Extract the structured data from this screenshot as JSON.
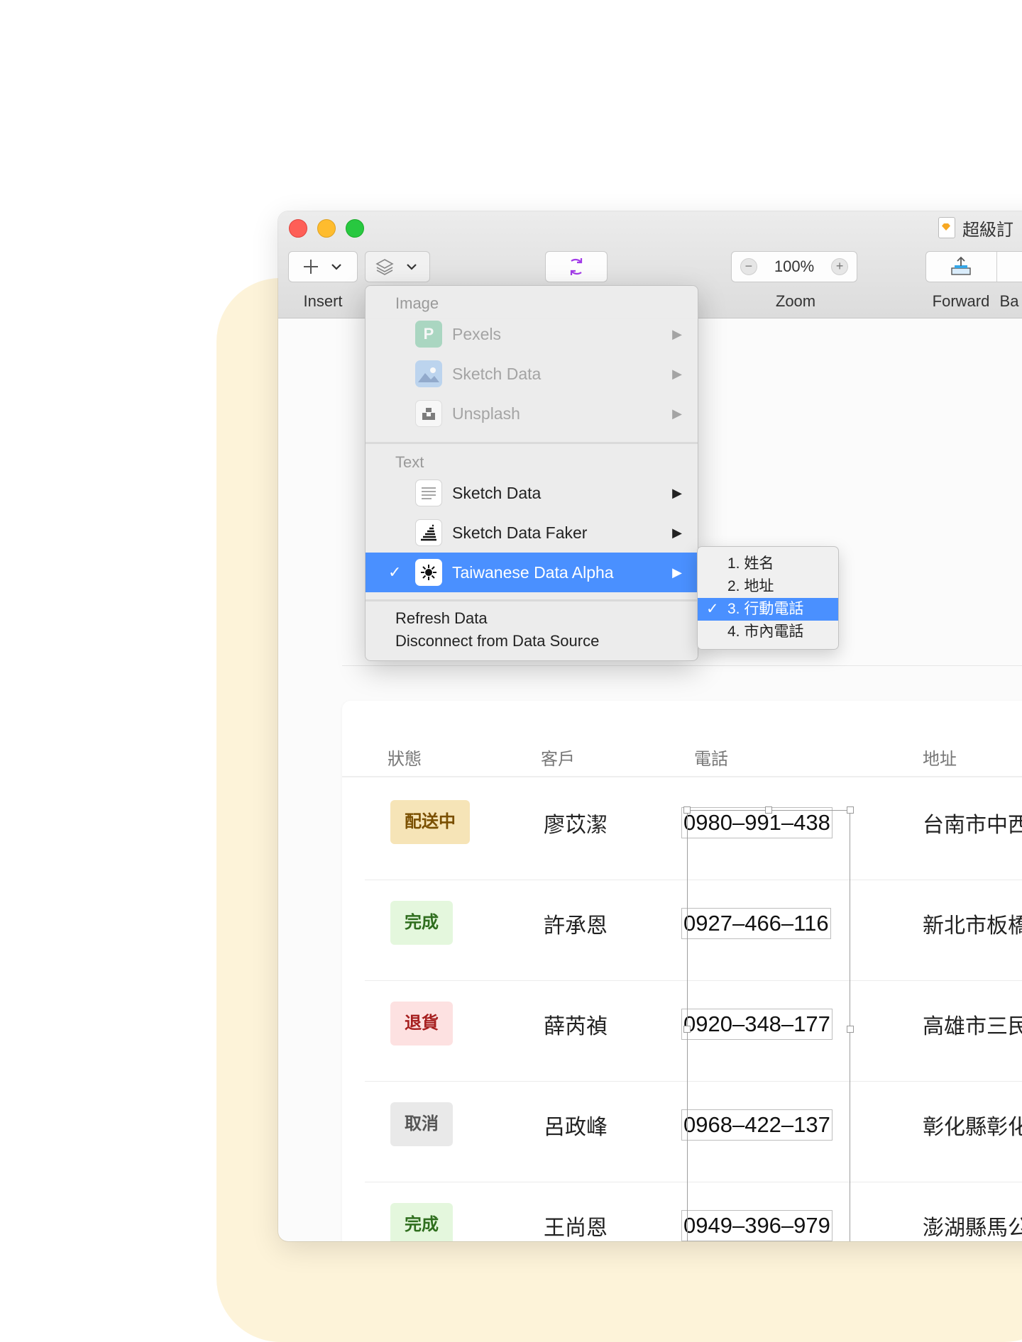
{
  "window": {
    "title": "超級訂"
  },
  "toolbar": {
    "insert_label": "Insert",
    "insert_icon": "plus-icon",
    "data_icon": "layers-icon",
    "sync_icon": "sync-icon",
    "zoom_label": "Zoom",
    "zoom_value": "100%",
    "forward_label": "Forward",
    "backward_label": "Ba"
  },
  "data_menu": {
    "image_section": "Image",
    "image_items": [
      {
        "label": "Pexels",
        "icon": "pexels-icon",
        "enabled": false
      },
      {
        "label": "Sketch Data",
        "icon": "landscape-icon",
        "enabled": false
      },
      {
        "label": "Unsplash",
        "icon": "unsplash-icon",
        "enabled": false
      }
    ],
    "text_section": "Text",
    "text_items": [
      {
        "label": "Sketch Data",
        "icon": "text-lines-icon",
        "enabled": true
      },
      {
        "label": "Sketch Data Faker",
        "icon": "faker-icon",
        "enabled": true
      },
      {
        "label": "Taiwanese Data Alpha",
        "icon": "sun-icon",
        "enabled": true,
        "checked": true,
        "highlighted": true
      }
    ],
    "refresh_label": "Refresh Data",
    "disconnect_label": "Disconnect from Data Source"
  },
  "submenu": {
    "items": [
      {
        "label": "1. 姓名",
        "checked": false
      },
      {
        "label": "2. 地址",
        "checked": false
      },
      {
        "label": "3. 行動電話",
        "checked": true
      },
      {
        "label": "4. 市內電話",
        "checked": false
      }
    ]
  },
  "table": {
    "headers": [
      "狀態",
      "客戶",
      "電話",
      "地址"
    ],
    "rows": [
      {
        "status": "配送中",
        "status_color": "#f6e4b7",
        "status_text_color": "#7a4f00",
        "name": "廖苡潔",
        "phone": "0980–991–438",
        "address": "台南市中西"
      },
      {
        "status": "完成",
        "status_color": "#e4f7dd",
        "status_text_color": "#2f6e1e",
        "name": "許承恩",
        "phone": "0927–466–116",
        "address": "新北市板橋"
      },
      {
        "status": "退貨",
        "status_color": "#fde1e1",
        "status_text_color": "#a61f1f",
        "name": "薛芮禎",
        "phone": "0920–348–177",
        "address": "高雄市三民"
      },
      {
        "status": "取消",
        "status_color": "#e9e9e9",
        "status_text_color": "#555555",
        "name": "呂政峰",
        "phone": "0968–422–137",
        "address": "彰化縣彰化"
      },
      {
        "status": "完成",
        "status_color": "#e4f7dd",
        "status_text_color": "#2f6e1e",
        "name": "王尚恩",
        "phone": "0949–396–979",
        "address": "澎湖縣馬公"
      }
    ]
  },
  "colors": {
    "accent": "#4a90ff",
    "sync_icon": "#a23be8",
    "background_blob": "#fdf3d9"
  }
}
